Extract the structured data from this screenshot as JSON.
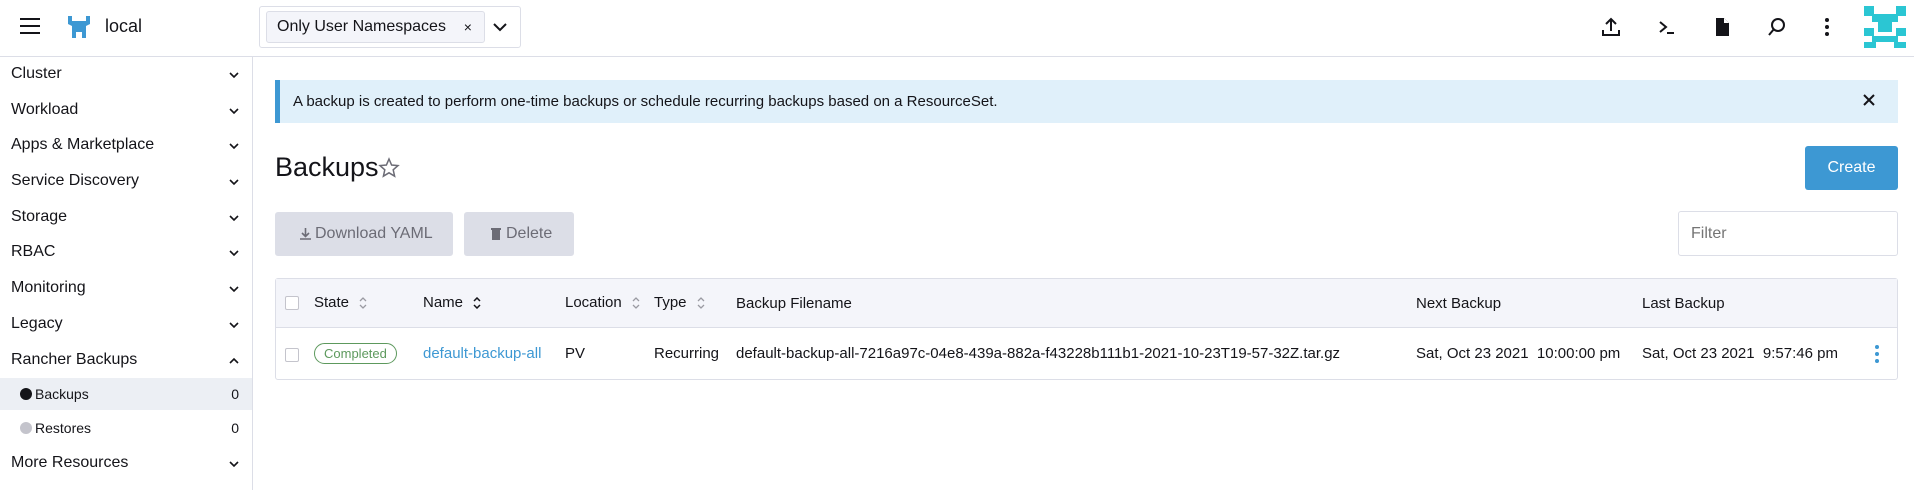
{
  "header": {
    "cluster_name": "local",
    "namespace_filter": "Only User Namespaces",
    "namespace_remove": "×",
    "icons": [
      "menu-icon",
      "upload-icon",
      "terminal-icon",
      "file-icon",
      "search-icon",
      "more-vertical-icon"
    ]
  },
  "sidebar": {
    "groups": [
      {
        "label": "Cluster"
      },
      {
        "label": "Workload"
      },
      {
        "label": "Apps & Marketplace"
      },
      {
        "label": "Service Discovery"
      },
      {
        "label": "Storage"
      },
      {
        "label": "RBAC"
      },
      {
        "label": "Monitoring"
      },
      {
        "label": "Legacy"
      },
      {
        "label": "Rancher Backups"
      },
      {
        "label": "More Resources"
      }
    ],
    "children": [
      {
        "label": "Backups",
        "count": "0",
        "active": true
      },
      {
        "label": "Restores",
        "count": "0",
        "active": false
      }
    ]
  },
  "banner": {
    "text": "A backup is created to perform one-time backups or schedule recurring backups based on a ResourceSet."
  },
  "page": {
    "title": "Backups",
    "create_label": "Create",
    "download_label": "Download YAML",
    "delete_label": "Delete",
    "filter_placeholder": "Filter"
  },
  "table": {
    "headers": {
      "state": "State",
      "name": "Name",
      "location": "Location",
      "type": "Type",
      "filename": "Backup Filename",
      "next": "Next Backup",
      "last": "Last Backup"
    },
    "rows": [
      {
        "state": "Completed",
        "name": "default-backup-all",
        "location": "PV",
        "type": "Recurring",
        "filename": "default-backup-all-7216a97c-04e8-439a-882a-f43228b111b1-2021-10-23T19-57-32Z.tar.gz",
        "next": "Sat, Oct 23 2021  10:00:00 pm",
        "last": "Sat, Oct 23 2021  9:57:46 pm"
      }
    ]
  },
  "colors": {
    "accent": "#3d98d3",
    "success": "#5d995d",
    "banner_bg": "#e0f0fa",
    "logo": "#3d98d3",
    "avatar": "#2bc6d3"
  }
}
